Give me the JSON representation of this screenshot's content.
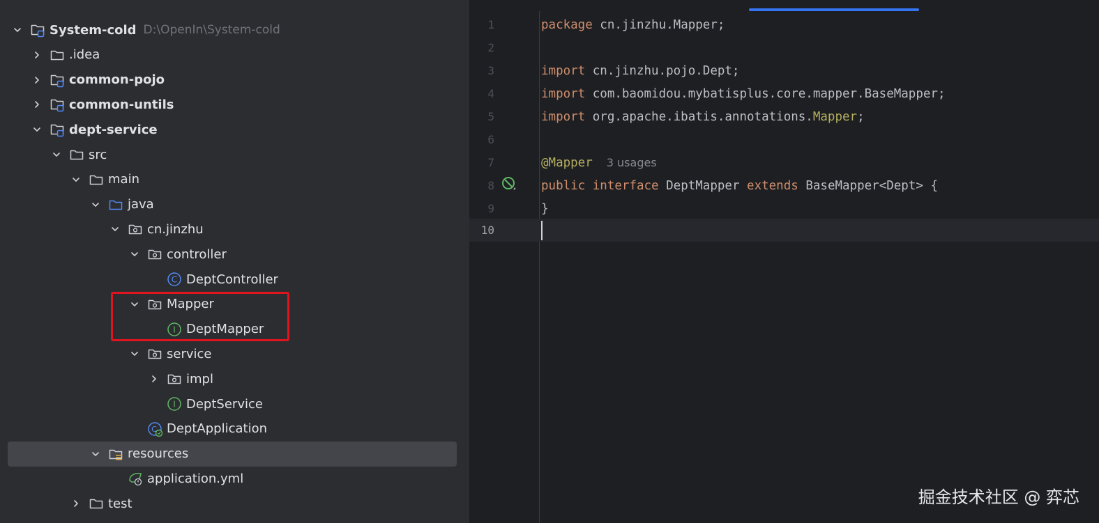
{
  "project_tree": {
    "rows": [
      {
        "label": "System-cold",
        "path": "D:\\OpenIn\\System-cold",
        "bold": true,
        "icon": "module-folder-icon",
        "expanded": true
      },
      {
        "label": ".idea",
        "bold": false,
        "icon": "folder-icon",
        "expanded": false
      },
      {
        "label": "common-pojo",
        "bold": true,
        "icon": "module-folder-icon",
        "expanded": false
      },
      {
        "label": "common-untils",
        "bold": true,
        "icon": "module-folder-icon",
        "expanded": false
      },
      {
        "label": "dept-service",
        "bold": true,
        "icon": "module-folder-icon",
        "expanded": true
      },
      {
        "label": "src",
        "bold": false,
        "icon": "folder-icon",
        "expanded": true
      },
      {
        "label": "main",
        "bold": false,
        "icon": "folder-icon",
        "expanded": true
      },
      {
        "label": "java",
        "bold": false,
        "icon": "source-folder-icon",
        "expanded": true
      },
      {
        "label": "cn.jinzhu",
        "bold": false,
        "icon": "package-icon",
        "expanded": true
      },
      {
        "label": "controller",
        "bold": false,
        "icon": "package-icon",
        "expanded": true
      },
      {
        "label": "DeptController",
        "bold": false,
        "icon": "class-icon",
        "expanded": null
      },
      {
        "label": "Mapper",
        "bold": false,
        "icon": "package-icon",
        "expanded": true
      },
      {
        "label": "DeptMapper",
        "bold": false,
        "icon": "interface-icon",
        "expanded": null
      },
      {
        "label": "service",
        "bold": false,
        "icon": "package-icon",
        "expanded": true
      },
      {
        "label": "impl",
        "bold": false,
        "icon": "package-icon",
        "expanded": false
      },
      {
        "label": "DeptService",
        "bold": false,
        "icon": "interface-icon",
        "expanded": null
      },
      {
        "label": "DeptApplication",
        "bold": false,
        "icon": "spring-boot-class-icon",
        "expanded": null
      },
      {
        "label": "resources",
        "bold": false,
        "icon": "resources-folder-icon",
        "expanded": true,
        "selected": true
      },
      {
        "label": "application.yml",
        "bold": false,
        "icon": "spring-yaml-icon",
        "expanded": null
      },
      {
        "label": "test",
        "bold": false,
        "icon": "folder-icon",
        "expanded": false
      }
    ]
  },
  "editor": {
    "line_numbers": [
      "1",
      "2",
      "3",
      "4",
      "5",
      "6",
      "7",
      "8",
      "9",
      "10"
    ],
    "lines": [
      {
        "kw": "package",
        "rest": " cn.jinzhu.Mapper;"
      },
      {},
      {
        "kw": "import",
        "rest": " cn.jinzhu.pojo.Dept;"
      },
      {
        "kw": "import",
        "rest": " com.baomidou.mybatisplus.core.mapper.BaseMapper;"
      },
      {
        "kw": "import",
        "rest": " org.apache.ibatis.annotations.",
        "ann": "Mapper",
        "tail": ";"
      },
      {},
      {
        "ann_start": "@Mapper",
        "hint": "3 usages"
      },
      {
        "kw": "public",
        "mid": " ",
        "kw2": "interface",
        "rest": " DeptMapper ",
        "kw3": "extends",
        "tail": " BaseMapper<Dept> {"
      },
      {
        "plain": "}"
      },
      {}
    ],
    "current_line": "10"
  },
  "watermark": "掘金技术社区 @ 弈芯",
  "colors": {
    "panel_bg": "#2b2d30",
    "editor_bg": "#1e1f22",
    "keyword": "#cf8e6d",
    "annotation": "#b3ae60",
    "highlight_box": "#e0141e",
    "tab_accent": "#3574f0"
  }
}
